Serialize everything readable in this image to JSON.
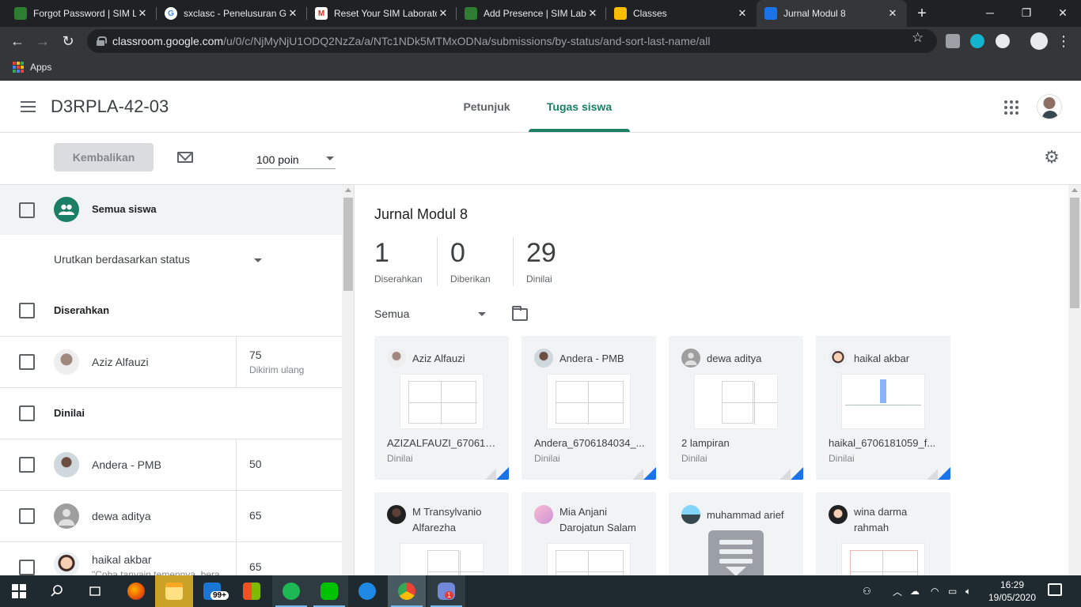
{
  "browser": {
    "tabs": [
      {
        "title": "Forgot Password | SIM La",
        "favicon_color": "#2e7d32"
      },
      {
        "title": "sxclasc - Penelusuran Goo",
        "favicon_color": "#4285f4"
      },
      {
        "title": "Reset Your SIM Laborato",
        "favicon_color": "#d93025"
      },
      {
        "title": "Add Presence | SIM Lab",
        "favicon_color": "#2e7d32"
      },
      {
        "title": "Classes",
        "favicon_color": "#fbbc04"
      },
      {
        "title": "Jurnal Modul 8",
        "favicon_color": "#1a73e8",
        "active": true
      }
    ],
    "url_host": "classroom.google.com",
    "url_path": "/u/0/c/NjMyNjU1ODQ2NzZa/a/NTc1NDk5MTMxODNa/submissions/by-status/and-sort-last-name/all",
    "bookmarks": {
      "apps_label": "Apps"
    }
  },
  "header": {
    "class_name": "D3RPLA-42-03",
    "tabs": [
      {
        "label": "Petunjuk"
      },
      {
        "label": "Tugas siswa"
      }
    ]
  },
  "actions": {
    "return_label": "Kembalikan",
    "points_value": "100 poin"
  },
  "left": {
    "all_students_label": "Semua siswa",
    "sort_label": "Urutkan berdasarkan status",
    "sections": [
      {
        "title": "Diserahkan",
        "students": [
          {
            "name": "Aziz Alfauzi",
            "grade": "75",
            "note": "Dikirim ulang"
          }
        ]
      },
      {
        "title": "Dinilai",
        "students": [
          {
            "name": "Andera - PMB",
            "grade": "50"
          },
          {
            "name": "dewa aditya",
            "grade": "65"
          },
          {
            "name": "haikal akbar",
            "grade": "65",
            "comment": "\"Coba tanyain temennya, bera"
          }
        ]
      }
    ]
  },
  "right": {
    "title": "Jurnal Modul 8",
    "stats": [
      {
        "value": "1",
        "label": "Diserahkan"
      },
      {
        "value": "0",
        "label": "Diberikan"
      },
      {
        "value": "29",
        "label": "Dinilai"
      }
    ],
    "filter_label": "Semua",
    "cards": [
      {
        "name": "Aziz Alfauzi",
        "file": "AZIZALFAUZI_670618...",
        "status": "Dinilai"
      },
      {
        "name": "Andera - PMB",
        "file": "Andera_6706184034_...",
        "status": "Dinilai"
      },
      {
        "name": "dewa aditya",
        "file": "2 lampiran",
        "status": "Dinilai"
      },
      {
        "name": "haikal akbar",
        "file": "haikal_6706181059_f...",
        "status": "Dinilai"
      },
      {
        "name": "M Transylvanio Alfarezha"
      },
      {
        "name": "Mia Anjani Darojatun Salam"
      },
      {
        "name": "muhammad arief"
      },
      {
        "name": "wina darma rahmah"
      }
    ]
  },
  "taskbar": {
    "store_badge": "99+",
    "discord_badge": "1",
    "time": "16:29",
    "date": "19/05/2020"
  }
}
